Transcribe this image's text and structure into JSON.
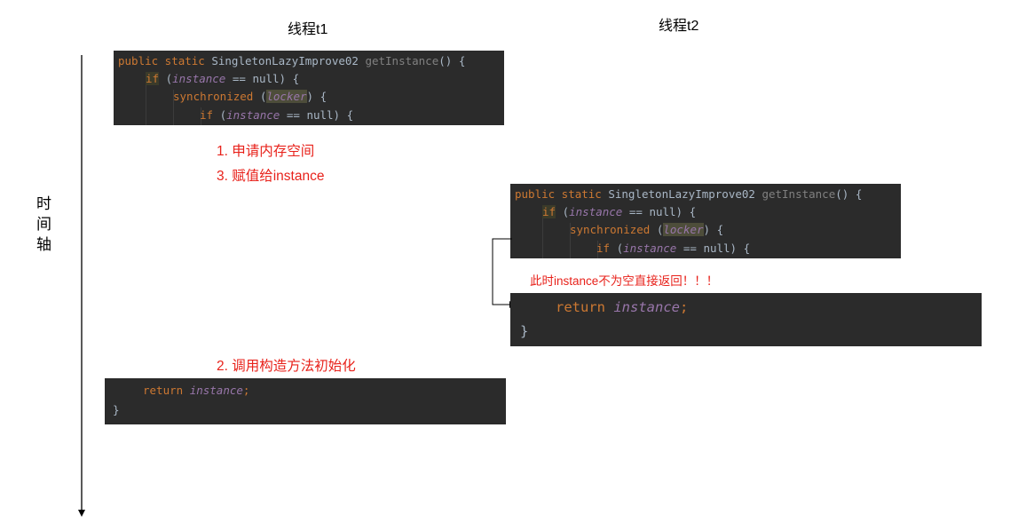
{
  "threads": {
    "t1_label": "线程t1",
    "t2_label": "线程t2"
  },
  "axis": {
    "chars": [
      "时",
      "间",
      "轴"
    ]
  },
  "t1": {
    "code": {
      "l1_kw": "public static ",
      "l1_cls": "SingletonLazyImprove02 ",
      "l1_fn": "getInstance",
      "l1_rest": "() {",
      "l2_kw": "if",
      "l2_open": " (",
      "l2_var": "instance",
      "l2_rest": " == null) {",
      "l3_kw": "synchronized",
      "l3_open": " (",
      "l3_var": "locker",
      "l3_rest": ") {",
      "l4_kw": "if",
      "l4_open": " (",
      "l4_var": "instance",
      "l4_rest": " == null) {"
    },
    "steps": {
      "s1": "1.  申请内存空间",
      "s3": "3.  赋值给instance",
      "s2": "2.  调用构造方法初始化"
    },
    "return_code": {
      "kw": "return ",
      "var": "instance",
      "semi": ";",
      "brace": "}"
    }
  },
  "t2": {
    "code": {
      "l1_kw": "public static ",
      "l1_cls": "SingletonLazyImprove02 ",
      "l1_fn": "getInstance",
      "l1_rest": "() {",
      "l2_kw": "if",
      "l2_open": " (",
      "l2_var": "instance",
      "l2_rest": " == null) {",
      "l3_kw": "synchronized",
      "l3_open": " (",
      "l3_var": "locker",
      "l3_rest": ") {",
      "l4_kw": "if",
      "l4_open": " (",
      "l4_var": "instance",
      "l4_rest": " == null) {"
    },
    "note": "此时instance不为空直接返回！！！",
    "return_code": {
      "kw": "return ",
      "var": "instance",
      "semi": ";",
      "brace": "}"
    }
  },
  "colors": {
    "keyword": "#cc7832",
    "variable": "#9876aa",
    "plain": "#a9b7c6",
    "code_bg": "#2b2b2b",
    "annotation_red": "#e8221b"
  }
}
